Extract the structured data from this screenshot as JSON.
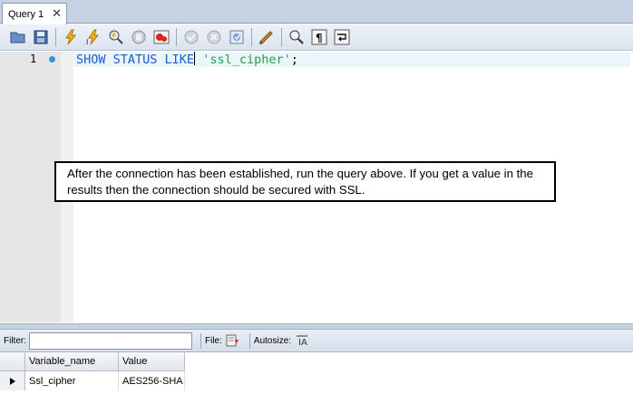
{
  "tab": {
    "label": "Query 1",
    "close": "✕"
  },
  "toolbar": {
    "icons": [
      "open-file-icon",
      "save-icon",
      "execute-icon",
      "execute-current-icon",
      "explain-icon",
      "stop-icon",
      "toggle-error-icon",
      "commit-icon",
      "rollback-icon",
      "autocommit-icon",
      "beautify-icon",
      "find-icon",
      "invisible-chars-icon",
      "wrap-icon"
    ]
  },
  "editor": {
    "line_number": "1",
    "code": {
      "kw1": "SHOW STATUS LIKE",
      "string": "'ssl_cipher'",
      "end": ";"
    }
  },
  "callout": {
    "text": "After the connection has been established, run the query above.  If you get a value in the results then the connection should be secured with SSL."
  },
  "filterbar": {
    "filter_label": "Filter:",
    "file_label": "File:",
    "autosize_label": "Autosize:"
  },
  "results": {
    "columns": [
      "Variable_name",
      "Value"
    ],
    "rows": [
      {
        "variable_name": "Ssl_cipher",
        "value": "AES256-SHA"
      }
    ]
  },
  "colors": {
    "keyword": "#1a5ad6",
    "string": "#2c9a4a",
    "accent": "#3b8fd8"
  }
}
